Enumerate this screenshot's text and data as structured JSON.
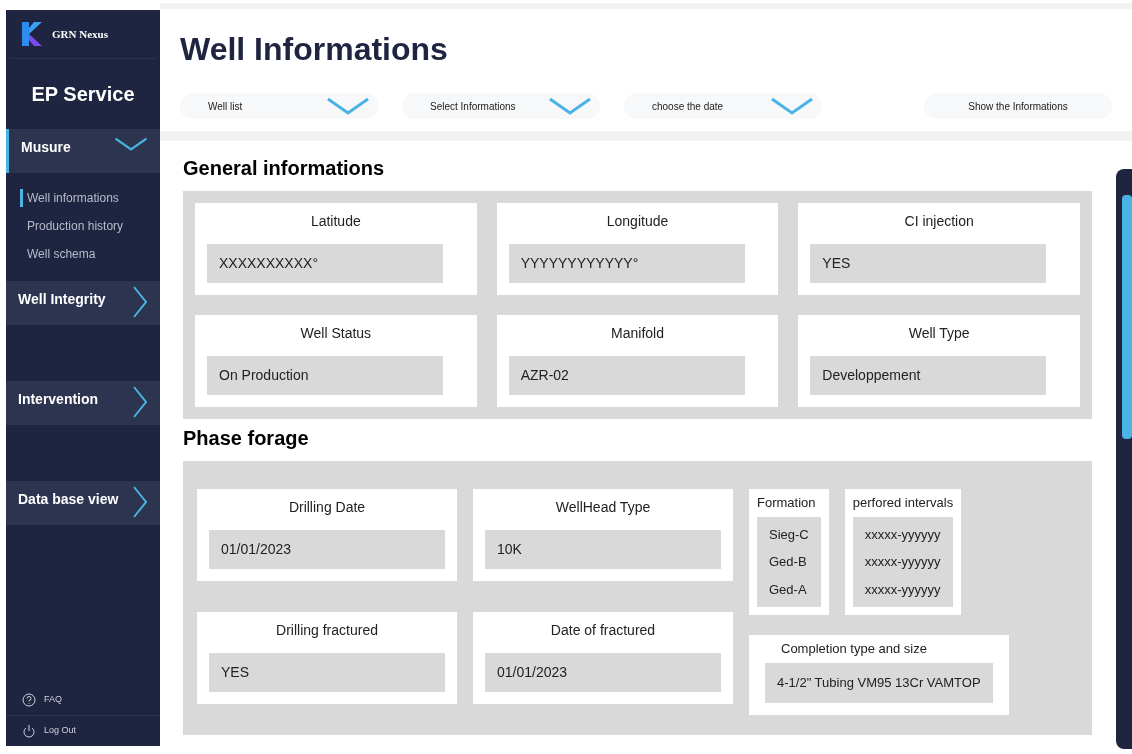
{
  "brand": {
    "name": "GRN Nexus"
  },
  "service": "EP Service",
  "sidebar": {
    "items": [
      {
        "label": "Musure",
        "expanded": true,
        "children": [
          {
            "label": "Well informations",
            "selected": true
          },
          {
            "label": "Production history",
            "selected": false
          },
          {
            "label": "Well schema",
            "selected": false
          }
        ]
      },
      {
        "label": "Well Integrity",
        "expanded": false
      },
      {
        "label": "Intervention",
        "expanded": false
      },
      {
        "label": "Data base view",
        "expanded": false
      }
    ],
    "footer": [
      {
        "kind": "help",
        "label": "FAQ"
      },
      {
        "kind": "logout",
        "label": "Log Out"
      }
    ]
  },
  "page_title": "Well Informations",
  "filters": [
    {
      "label": "Well list"
    },
    {
      "label": "Select Informations"
    },
    {
      "label": "choose the date"
    }
  ],
  "show_button": "Show the Informations",
  "general": {
    "title": "General informations",
    "fields": [
      {
        "label": "Latitude",
        "value": "XXXXXXXXXX°"
      },
      {
        "label": "Longitude",
        "value": "YYYYYYYYYYYY°"
      },
      {
        "label": "CI injection",
        "value": "YES"
      },
      {
        "label": "Well Status",
        "value": "On Production"
      },
      {
        "label": "Manifold",
        "value": "AZR-02"
      },
      {
        "label": "Well Type",
        "value": "Developpement"
      }
    ]
  },
  "phase": {
    "title": "Phase forage",
    "fields": [
      {
        "label": "Drilling Date",
        "value": "01/01/2023"
      },
      {
        "label": "WellHead Type",
        "value": "10K"
      },
      {
        "label": "Drilling fractured",
        "value": "YES"
      },
      {
        "label": "Date of fractured",
        "value": "01/01/2023"
      }
    ],
    "lists": [
      {
        "label": "Formation",
        "values": [
          "Sieg-C",
          "Ged-B",
          "Ged-A"
        ]
      },
      {
        "label": "perfored intervals",
        "values": [
          "xxxxx-yyyyyy",
          "xxxxx-yyyyyy",
          "xxxxx-yyyyyy"
        ]
      }
    ],
    "completion": {
      "label": "Completion type and size",
      "value": "4-1/2\" Tubing VM95 13Cr VAMTOP"
    }
  }
}
